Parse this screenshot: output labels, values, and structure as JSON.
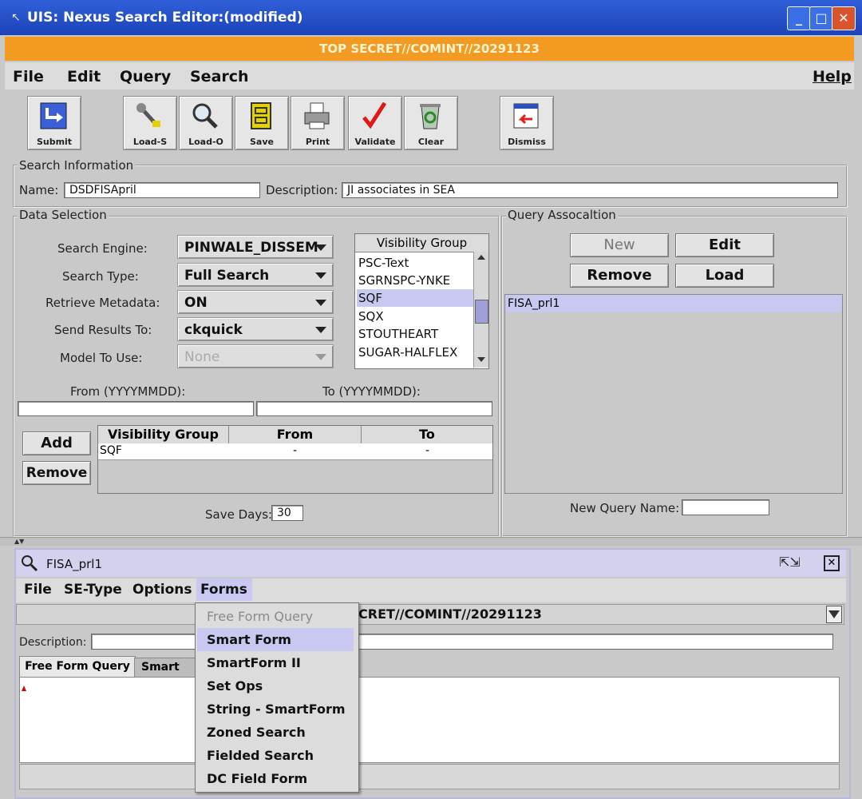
{
  "window": {
    "title": "UIS: Nexus Search Editor:(modified)",
    "classification": "TOP SECRET//COMINT//20291123"
  },
  "menubar": {
    "file": "File",
    "edit": "Edit",
    "query": "Query",
    "search": "Search",
    "help": "Help"
  },
  "toolbar": [
    {
      "label": "Submit",
      "icon": "submit-arrow-icon"
    },
    {
      "label": "Load-S",
      "icon": "wrench-icon"
    },
    {
      "label": "Load-O",
      "icon": "magnifier-icon"
    },
    {
      "label": "Save",
      "icon": "cabinet-icon"
    },
    {
      "label": "Print",
      "icon": "printer-icon"
    },
    {
      "label": "Validate",
      "icon": "checkmark-icon"
    },
    {
      "label": "Clear",
      "icon": "recycle-bin-icon"
    },
    {
      "label": "Dismiss",
      "icon": "dismiss-icon"
    }
  ],
  "search_info": {
    "legend": "Search Information",
    "name_label": "Name:",
    "name_value": "DSDFISApril",
    "desc_label": "Description:",
    "desc_value": "JI associates in SEA"
  },
  "data_selection": {
    "legend": "Data Selection",
    "search_engine": {
      "label": "Search Engine:",
      "value": "PINWALE_DISSEM"
    },
    "search_type": {
      "label": "Search Type:",
      "value": "Full Search"
    },
    "retrieve_metadata": {
      "label": "Retrieve Metadata:",
      "value": "ON"
    },
    "send_results": {
      "label": "Send Results To:",
      "value": "ckquick"
    },
    "model": {
      "label": "Model To Use:",
      "value": "None"
    },
    "visibility_group": {
      "header": "Visibility Group",
      "items": [
        "PSC-Text",
        "SGRNSPC-YNKE",
        "SQF",
        "SQX",
        "STOUTHEART",
        "SUGAR-HALFLEX"
      ],
      "selected": "SQF"
    },
    "from_label": "From (YYYYMMDD):",
    "to_label": "To (YYYYMMDD):",
    "add_label": "Add",
    "remove_label": "Remove",
    "table": {
      "headers": [
        "Visibility Group",
        "From",
        "To"
      ],
      "rows": [
        [
          "SQF",
          "-",
          "-"
        ]
      ]
    },
    "save_days_label": "Save Days:",
    "save_days_value": "30"
  },
  "query_assoc": {
    "legend": "Query Assocaltion",
    "new_label": "New",
    "edit_label": "Edit",
    "remove_label": "Remove",
    "load_label": "Load",
    "items": [
      "FISA_prl1"
    ],
    "new_query_label": "New Query Name:"
  },
  "subwindow": {
    "title": "FISA_prl1",
    "menus": {
      "file": "File",
      "setype": "SE-Type",
      "options": "Options",
      "forms": "Forms"
    },
    "classification": "CRET//COMINT//20291123",
    "description_label": "Description:",
    "tabs": [
      "Free Form Query",
      "Smart Fo"
    ],
    "forms_menu": [
      "Free Form Query",
      "Smart Form",
      "SmartForm II",
      "Set Ops",
      "String - SmartForm",
      "Zoned Search",
      "Fielded Search",
      "DC Field Form"
    ],
    "forms_selected": "Smart Form"
  },
  "colors": {
    "titlebar": "#2350c8",
    "banner": "#f39a22",
    "selection": "#c8c8f0"
  }
}
